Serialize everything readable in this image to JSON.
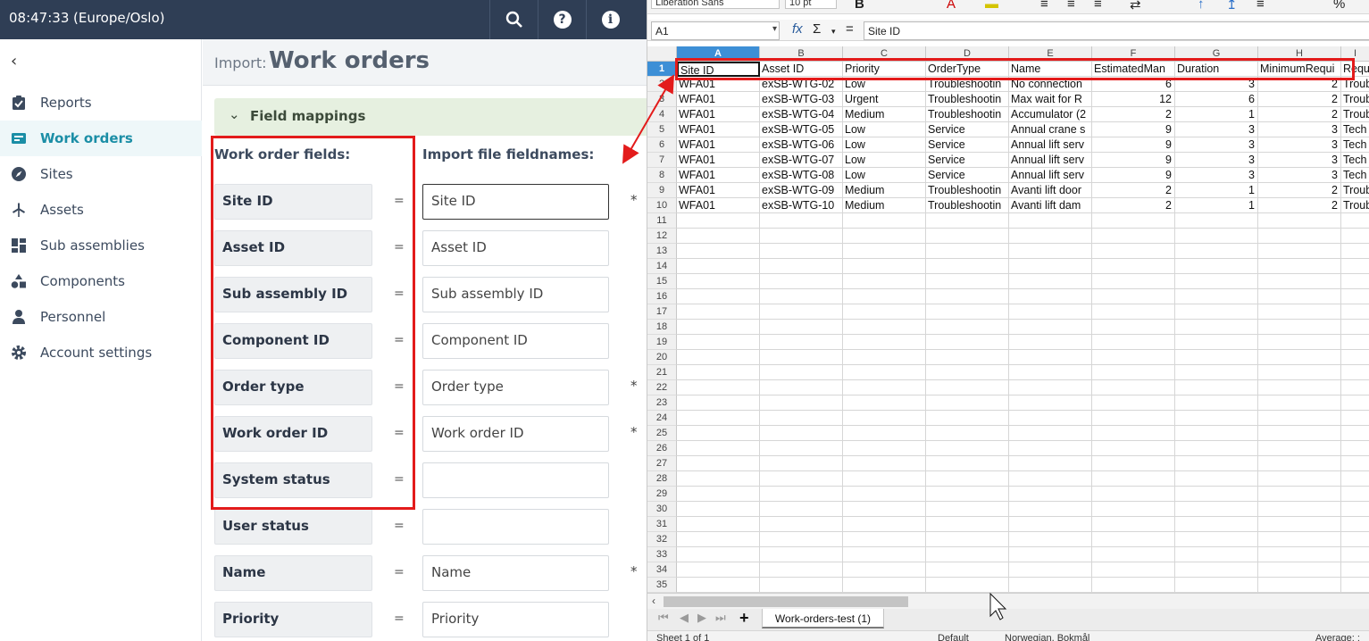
{
  "topbar": {
    "time": "08:47:33",
    "timezone": "(Europe/Oslo)",
    "icons": [
      "search-icon",
      "help-icon",
      "info-icon"
    ]
  },
  "sidebar": {
    "items": [
      {
        "label": "Reports",
        "icon": "clipboard-check-icon"
      },
      {
        "label": "Work orders",
        "icon": "inbox-icon",
        "active": true
      },
      {
        "label": "Sites",
        "icon": "compass-icon"
      },
      {
        "label": "Assets",
        "icon": "wind-turbine-icon"
      },
      {
        "label": "Sub assemblies",
        "icon": "grid-icon"
      },
      {
        "label": "Components",
        "icon": "shapes-icon"
      },
      {
        "label": "Personnel",
        "icon": "person-icon"
      },
      {
        "label": "Account settings",
        "icon": "gear-icon"
      }
    ]
  },
  "page": {
    "prefix": "Import:",
    "title": "Work orders"
  },
  "mappings": {
    "section_label": "Field mappings",
    "left_header": "Work order fields:",
    "right_header": "Import file fieldnames:",
    "rows": [
      {
        "field": "Site ID",
        "value": "Site ID",
        "required": true
      },
      {
        "field": "Asset ID",
        "value": "Asset ID",
        "required": false
      },
      {
        "field": "Sub assembly ID",
        "value": "Sub assembly ID",
        "required": false
      },
      {
        "field": "Component ID",
        "value": "Component ID",
        "required": false
      },
      {
        "field": "Order type",
        "value": "Order type",
        "required": true
      },
      {
        "field": "Work order ID",
        "value": "Work order ID",
        "required": true
      },
      {
        "field": "System status",
        "value": "",
        "required": false
      },
      {
        "field": "User status",
        "value": "",
        "required": false
      },
      {
        "field": "Name",
        "value": "Name",
        "required": true
      },
      {
        "field": "Priority",
        "value": "Priority",
        "required": false
      }
    ],
    "equals": "=",
    "required_mark": "*"
  },
  "spreadsheet": {
    "font_name": "Liberation Sans",
    "font_size": "10 pt",
    "name_box": "A1",
    "formula_value": "Site ID",
    "fx_label": "fx",
    "sigma_label": "Σ",
    "equals_label": "=",
    "columns": [
      "A",
      "B",
      "C",
      "D",
      "E",
      "F",
      "G",
      "H",
      "I"
    ],
    "header_row": [
      "Site ID",
      "Asset ID",
      "Priority",
      "OrderType",
      "Name",
      "EstimatedMan",
      "Duration",
      "MinimumRequi",
      "Requ"
    ],
    "data_rows": [
      [
        "WFA01",
        "exSB-WTG-02",
        "Low",
        "Troubleshootin",
        "No connection",
        "6",
        "3",
        "2",
        "Troub"
      ],
      [
        "WFA01",
        "exSB-WTG-03",
        "Urgent",
        "Troubleshootin",
        "Max wait for R",
        "12",
        "6",
        "2",
        "Troub"
      ],
      [
        "WFA01",
        "exSB-WTG-04",
        "Medium",
        "Troubleshootin",
        "Accumulator (2",
        "2",
        "1",
        "2",
        "Troub"
      ],
      [
        "WFA01",
        "exSB-WTG-05",
        "Low",
        "Service",
        "Annual crane s",
        "9",
        "3",
        "3",
        "Tech"
      ],
      [
        "WFA01",
        "exSB-WTG-06",
        "Low",
        "Service",
        "Annual lift serv",
        "9",
        "3",
        "3",
        "Tech"
      ],
      [
        "WFA01",
        "exSB-WTG-07",
        "Low",
        "Service",
        "Annual lift serv",
        "9",
        "3",
        "3",
        "Tech"
      ],
      [
        "WFA01",
        "exSB-WTG-08",
        "Low",
        "Service",
        "Annual lift serv",
        "9",
        "3",
        "3",
        "Tech"
      ],
      [
        "WFA01",
        "exSB-WTG-09",
        "Medium",
        "Troubleshootin",
        "Avanti lift door",
        "2",
        "1",
        "2",
        "Troub"
      ],
      [
        "WFA01",
        "exSB-WTG-10",
        "Medium",
        "Troubleshootin",
        "Avanti lift dam",
        "2",
        "1",
        "2",
        "Troub"
      ]
    ],
    "row_count": 35,
    "sheet_tab": "Work-orders-test (1)",
    "add_sheet": "+",
    "status": {
      "sheet": "Sheet 1 of 1",
      "style": "Default",
      "language": "Norwegian, Bokmål",
      "summary": "Average: ;"
    }
  },
  "colors": {
    "topbar": "#2f3e55",
    "accent": "#1b8ea6",
    "highlight": "#e31b1b",
    "mapping_bar": "#e6f0e0"
  }
}
